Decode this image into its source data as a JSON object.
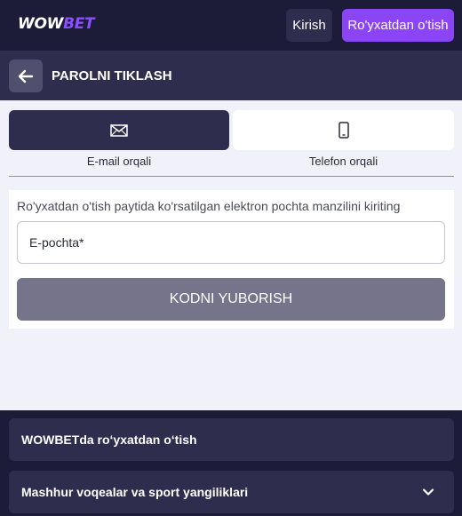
{
  "header": {
    "logo_part1": "WOW",
    "logo_part2": "BET",
    "login_label": "Kirish",
    "register_label": "Ro'yxatdan o'tish"
  },
  "page": {
    "title": "PAROLNI TIKLASH"
  },
  "tabs": [
    {
      "label": "E-mail orqali",
      "icon": "envelope-icon",
      "active": true
    },
    {
      "label": "Telefon orqali",
      "icon": "phone-icon",
      "active": false
    }
  ],
  "form": {
    "hint": "Ro'yxatdan o'tish paytida ko'rsatilgan elektron pochta manzilini kiriting",
    "email_placeholder": "E-pochta*",
    "email_value": "",
    "submit_label": "KODNI YUBORISH"
  },
  "footer": {
    "items": [
      {
        "label": "WOWBETda ro‘yxatdan o‘tish",
        "expandable": false
      },
      {
        "label": "Mashhur voqealar va sport yangiliklari",
        "expandable": true,
        "icon": "chevron-down-icon"
      }
    ]
  },
  "colors": {
    "header_bg": "#1d1c38",
    "titlebar_bg": "#2e2d4e",
    "accent": "#8c45f5",
    "logo_accent": "#8a4fff",
    "submit_disabled": "#75748a",
    "page_bg": "#f1f2f9"
  }
}
